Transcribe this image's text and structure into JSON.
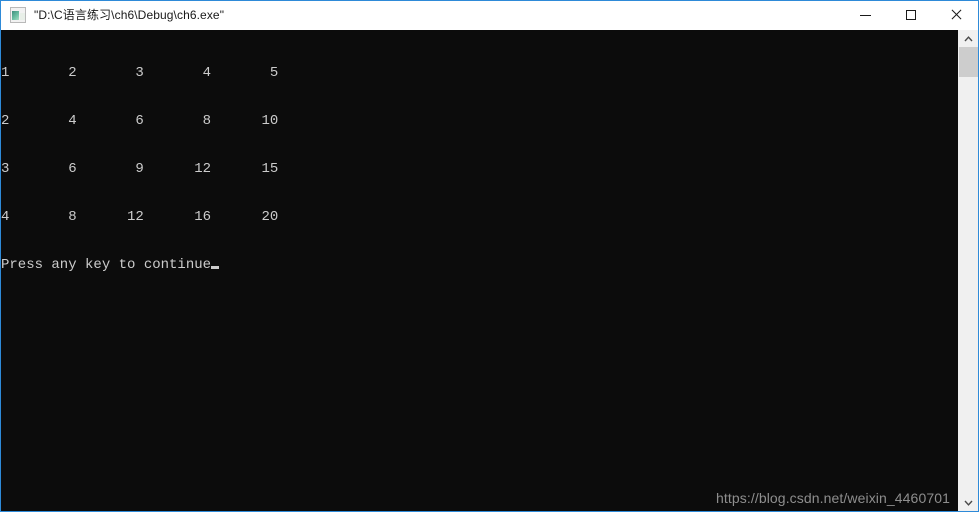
{
  "window": {
    "title": "\"D:\\C语言练习\\ch6\\Debug\\ch6.exe\"",
    "icon_name": "console-app-icon",
    "accent_border_color": "#2e8ad8",
    "titlebar_bg": "#ffffff",
    "console_bg": "#0c0c0c",
    "console_fg": "#cccccc",
    "buttons": {
      "minimize_label": "Minimize",
      "maximize_label": "Maximize",
      "close_label": "Close"
    }
  },
  "console": {
    "lines": [
      "1       2       3       4       5",
      "2       4       6       8      10",
      "3       6       9      12      15",
      "4       8      12      16      20"
    ],
    "prompt": "Press any key to continue",
    "cursor_visible": true
  },
  "table_data": {
    "description": "multiplication table rows 1-4 by columns 1-5",
    "rows": [
      [
        1,
        2,
        3,
        4,
        5
      ],
      [
        2,
        4,
        6,
        8,
        10
      ],
      [
        3,
        6,
        9,
        12,
        15
      ],
      [
        4,
        8,
        12,
        16,
        20
      ]
    ]
  },
  "watermark": {
    "text": "https://blog.csdn.net/weixin_4460701",
    "color": "#8e8e8e"
  },
  "scrollbar": {
    "up_arrow_name": "scroll-up",
    "down_arrow_name": "scroll-down",
    "thumb_position": "top"
  }
}
